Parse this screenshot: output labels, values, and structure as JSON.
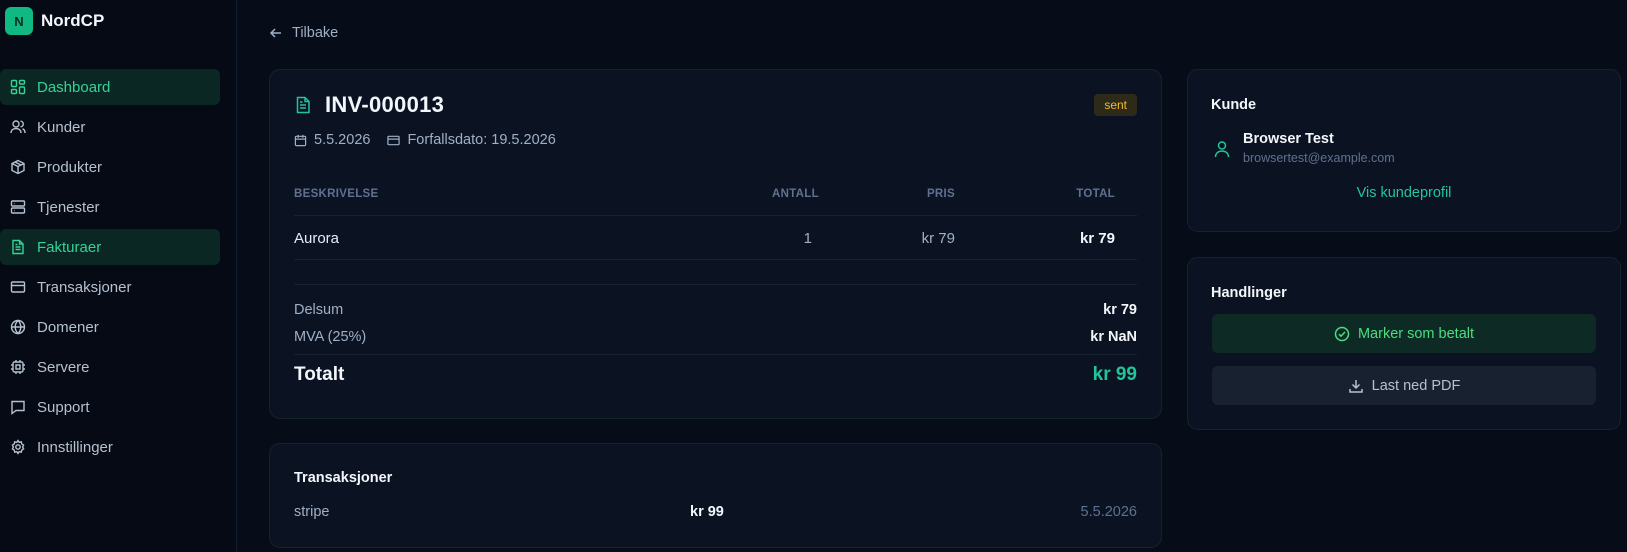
{
  "brand": {
    "logo_letter": "N",
    "name": "NordCP",
    "accent": "#10b981"
  },
  "sidebar": {
    "items": [
      {
        "label": "Dashboard",
        "icon": "dashboard-icon"
      },
      {
        "label": "Kunder",
        "icon": "users-icon"
      },
      {
        "label": "Produkter",
        "icon": "package-icon"
      },
      {
        "label": "Tjenester",
        "icon": "server-stack-icon"
      },
      {
        "label": "Fakturaer",
        "icon": "invoice-icon"
      },
      {
        "label": "Transaksjoner",
        "icon": "credit-card-icon"
      },
      {
        "label": "Domener",
        "icon": "globe-icon"
      },
      {
        "label": "Servere",
        "icon": "cpu-icon"
      },
      {
        "label": "Support",
        "icon": "chat-icon"
      },
      {
        "label": "Innstillinger",
        "icon": "gear-icon"
      }
    ]
  },
  "back": {
    "label": "Tilbake"
  },
  "invoice": {
    "number": "INV-000013",
    "status": "sent",
    "date": "5.5.2026",
    "due_date": "Forfallsdato: 19.5.2026",
    "columns": {
      "description": "BESKRIVELSE",
      "quantity": "ANTALL",
      "price": "PRIS",
      "total": "TOTAL"
    },
    "lines": [
      {
        "description": "Aurora",
        "quantity": "1",
        "price": "kr 79",
        "total": "kr 79"
      }
    ],
    "subtotal_label": "Delsum",
    "subtotal_value": "kr 79",
    "vat_label": "MVA (25%)",
    "vat_value": "kr NaN",
    "total_label": "Totalt",
    "total_value": "kr 99"
  },
  "transactions": {
    "title": "Transaksjoner",
    "rows": [
      {
        "method": "stripe",
        "amount": "kr 99",
        "date": "5.5.2026"
      }
    ]
  },
  "customer": {
    "title": "Kunde",
    "name": "Browser Test",
    "email": "browsertest@example.com",
    "profile_link": "Vis kundeprofil"
  },
  "actions": {
    "title": "Handlinger",
    "mark_paid": "Marker som betalt",
    "download_pdf": "Last ned PDF"
  }
}
